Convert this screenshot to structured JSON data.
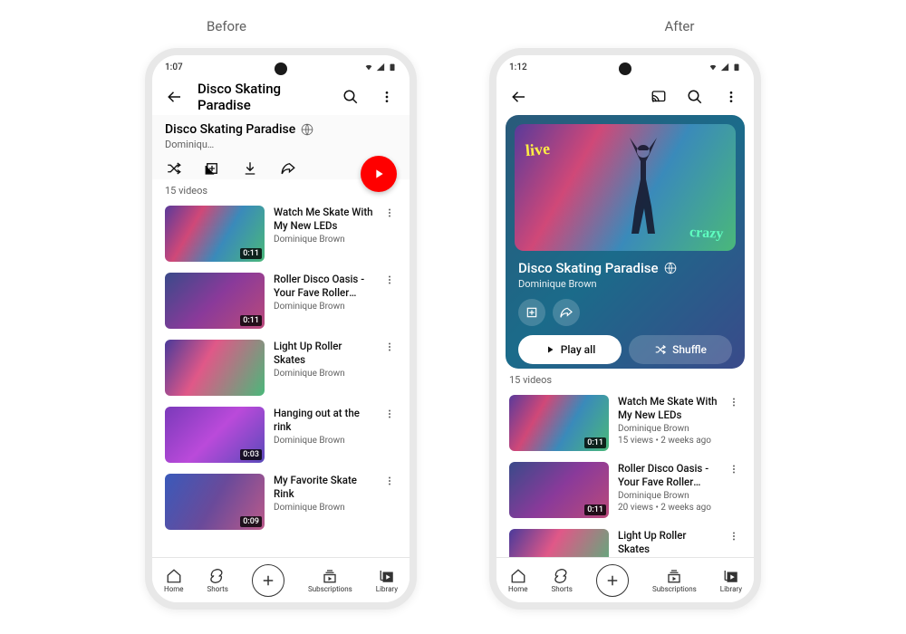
{
  "labels": {
    "before": "Before",
    "after": "After"
  },
  "status": {
    "time_before": "1:07",
    "time_after": "1:12"
  },
  "playlist": {
    "title": "Disco Skating Paradise",
    "author_short": "Dominiqu…",
    "author_full": "Dominique Brown",
    "count": "15 videos"
  },
  "buttons": {
    "play_all": "Play all",
    "shuffle": "Shuffle"
  },
  "videos_before": [
    {
      "title": "Watch Me Skate With My New LEDs",
      "author": "Dominique Brown",
      "dur": "0:11",
      "thumb": "t1"
    },
    {
      "title": "Roller Disco Oasis - Your Fave Roller Disco Paradise",
      "author": "Dominique Brown",
      "dur": "0:11",
      "thumb": "t2"
    },
    {
      "title": "Light Up Roller Skates",
      "author": "Dominique Brown",
      "dur": "",
      "thumb": "t3"
    },
    {
      "title": "Hanging out at the rink",
      "author": "Dominique Brown",
      "dur": "0:03",
      "thumb": "t4"
    },
    {
      "title": "My Favorite Skate Rink",
      "author": "Dominique Brown",
      "dur": "0:09",
      "thumb": "t5"
    }
  ],
  "videos_after": [
    {
      "title": "Watch Me Skate With My New LEDs",
      "author": "Dominique Brown",
      "stats": "15 views • 2 weeks ago",
      "dur": "0:11",
      "thumb": "t1"
    },
    {
      "title": "Roller Disco Oasis - Your Fave Roller Disco Paradise",
      "author": "Dominique Brown",
      "stats": "20 views • 2 weeks ago",
      "dur": "0:11",
      "thumb": "t2"
    },
    {
      "title": "Light Up Roller Skates",
      "author": "Dominique Brown",
      "stats": "",
      "dur": "",
      "thumb": "t3"
    }
  ],
  "nav": {
    "home": "Home",
    "shorts": "Shorts",
    "subs": "Subscriptions",
    "library": "Library"
  }
}
